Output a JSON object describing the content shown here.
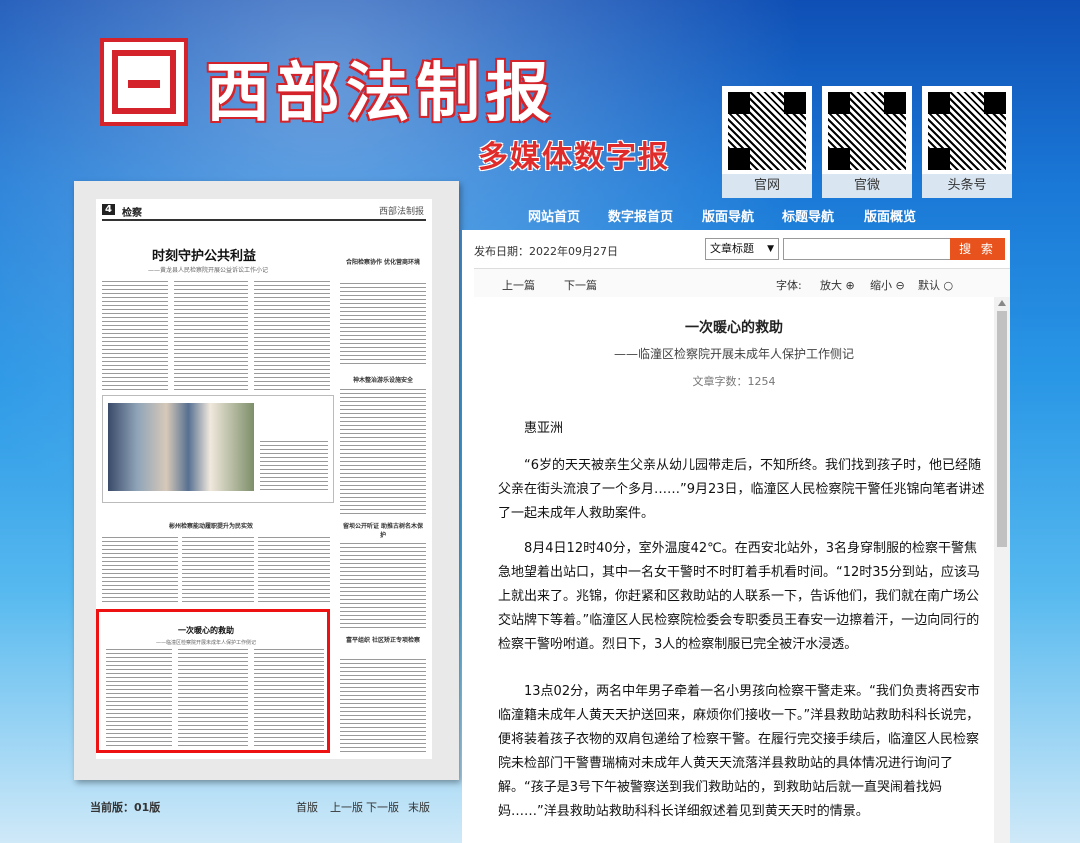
{
  "header": {
    "title": "西部法制报",
    "subtitle": "多媒体数字报",
    "qr_codes": [
      {
        "label": "官网",
        "icon": "qr-code-icon"
      },
      {
        "label": "官微",
        "icon": "qr-code-icon"
      },
      {
        "label": "头条号",
        "icon": "qr-code-icon"
      }
    ]
  },
  "nav": {
    "items": [
      "网站首页",
      "数字报首页",
      "版面导航",
      "标题导航",
      "版面概览"
    ]
  },
  "paper": {
    "page_no": "4",
    "section": "检察",
    "masthead": "西部法制报",
    "main_title": "时刻守护公共利益",
    "main_subtitle": "——黄龙县人民检察院开展公益诉讼工作小记",
    "side_heads": [
      "合阳检察协作 优化营商环境",
      "神木整治游乐设施安全",
      "彬州检察能动履职提升为民实效",
      "留坝公开听证 助推古树名木保护",
      "富平组织 社区矫正专项检察"
    ],
    "highlight_title": "一次暖心的救助",
    "highlight_subtitle": "——临潼区检察院开展未成年人保护工作侧记"
  },
  "edition": {
    "current": "当前版：01版",
    "links": [
      "首版",
      "上一版",
      "下一版",
      "末版"
    ]
  },
  "meta": {
    "publish_date": "发布日期：2022年09月27日",
    "search_field_selected": "文章标题",
    "search_placeholder": "",
    "search_button": "搜 索"
  },
  "toolbar": {
    "prev": "上一篇",
    "next": "下一篇",
    "font_label": "字体:",
    "zoom_in": "放大",
    "zoom_out": "缩小",
    "default": "默认"
  },
  "article": {
    "title": "一次暖心的救助",
    "subtitle": "——临潼区检察院开展未成年人保护工作侧记",
    "word_count": "文章字数：1254",
    "author": "惠亚洲",
    "paragraphs": [
      "“6岁的天天被亲生父亲从幼儿园带走后，不知所终。我们找到孩子时，他已经随父亲在街头流浪了一个多月……”9月23日，临潼区人民检察院干警任兆锦向笔者讲述了一起未成年人救助案件。",
      "8月4日12时40分，室外温度42℃。在西安北站外，3名身穿制服的检察干警焦急地望着出站口，其中一名女干警时不时盯着手机看时间。“12时35分到站，应该马上就出来了。兆锦，你赶紧和区救助站的人联系一下，告诉他们，我们就在南广场公交站牌下等着。”临潼区人民检察院检委会专职委员王春安一边擦着汗，一边向同行的检察干警吩咐道。烈日下，3人的检察制服已完全被汗水浸透。",
      "13点02分，两名中年男子牵着一名小男孩向检察干警走来。“我们负责将西安市临潼籍未成年人黄天天护送回来，麻烦你们接收一下。”洋县救助站救助科科长说完，便将装着孩子衣物的双肩包递给了检察干警。在履行完交接手续后，临潼区人民检察院未检部门干警曹瑞楠对未成年人黄天天流落洋县救助站的具体情况进行询问了解。“孩子是3号下午被警察送到我们救助站的，到救助站后就一直哭闹着找妈妈……”洋县救助站救助科科长详细叙述着见到黄天天时的情景。"
    ]
  },
  "colors": {
    "brand_red": "#d4232a",
    "search_orange": "#e8531d",
    "highlight_border": "#ee1111"
  }
}
